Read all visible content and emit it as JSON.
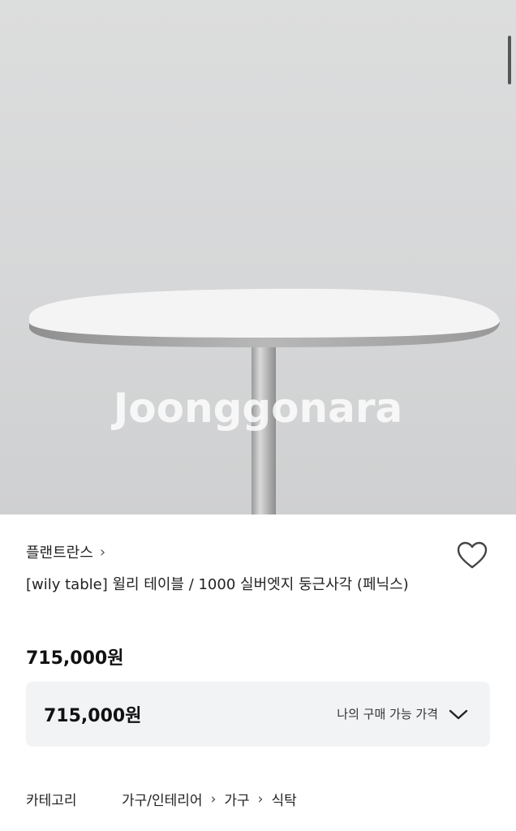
{
  "product_image": {
    "watermark": "Joonggonara"
  },
  "seller": {
    "name": "플랜트란스",
    "chevron_icon": "chevron-right-icon"
  },
  "product": {
    "title": "[wily table] 윌리 테이블 / 1000 실버엣지 둥근사각 (페닉스)",
    "price": "715,000원"
  },
  "price_box": {
    "price": "715,000원",
    "hint": "나의 구매 가능 가격",
    "icon": "chevron-down-icon"
  },
  "category": {
    "label": "카테고리",
    "path": [
      "가구/인테리어",
      "가구",
      "식탁"
    ]
  },
  "favorite": {
    "icon": "heart-outline-icon"
  }
}
